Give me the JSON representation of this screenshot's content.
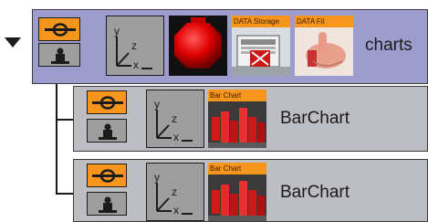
{
  "tree": {
    "expand_icon": "triangle-down-icon",
    "root": {
      "label": "charts",
      "thumbnails": [
        {
          "icon": "red-ball-icon"
        },
        {
          "icon": "data-storage-icon",
          "caption": "DATA Storage"
        },
        {
          "icon": "data-fit-icon",
          "caption": "DATA Fit"
        }
      ]
    },
    "children": [
      {
        "label": "BarChart",
        "thumbnail_caption": "Bar Chart"
      },
      {
        "label": "BarChart",
        "thumbnail_caption": "Bar Chart"
      }
    ]
  },
  "colors": {
    "root_row": "#9c9ccd",
    "child_row": "#bdbdc4",
    "toggle_accent": "#f7951c",
    "button_gray": "#9e9e9e"
  }
}
